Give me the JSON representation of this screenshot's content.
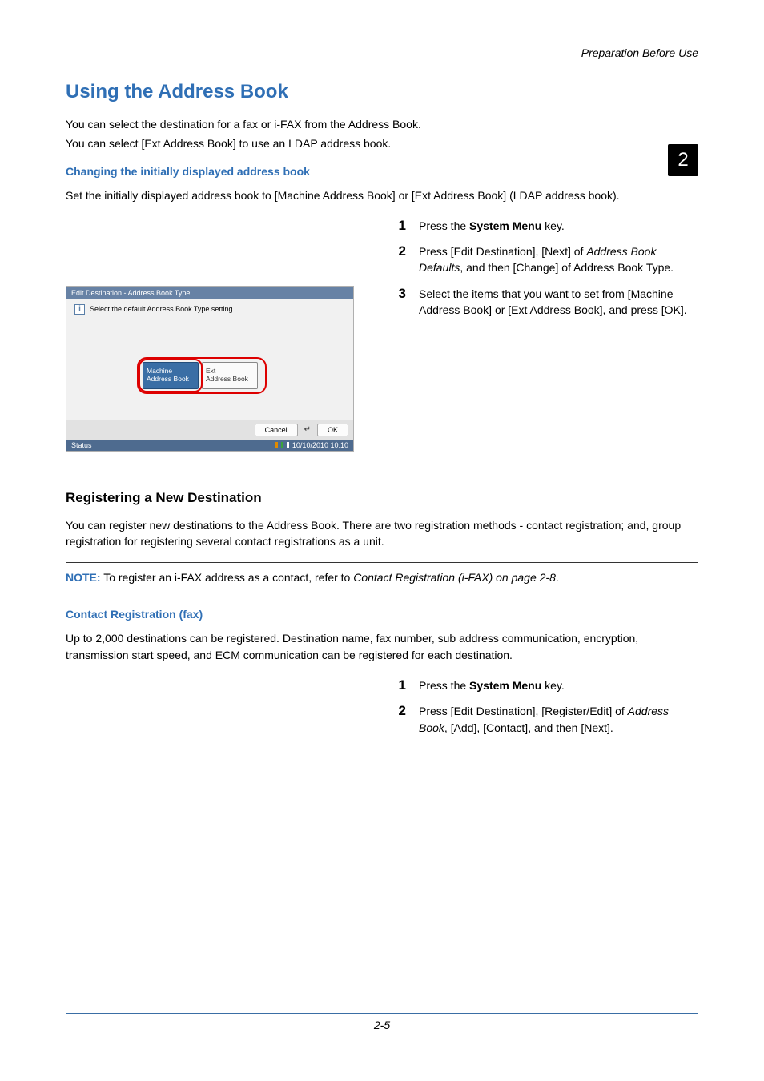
{
  "running_header": "Preparation Before Use",
  "chapter_number": "2",
  "section_title": "Using the Address Book",
  "intro": {
    "p1": "You can select the destination for a fax or i-FAX from the Address Book.",
    "p2": "You can select [Ext Address Book] to use an LDAP address book."
  },
  "sub_changing": {
    "heading": "Changing the initially displayed address book",
    "intro": "Set the initially displayed address book to [Machine Address Book] or [Ext Address Book] (LDAP address book).",
    "steps": {
      "s1_num": "1",
      "s1_text_a": "Press the ",
      "s1_text_b": "System Menu",
      "s1_text_c": " key.",
      "s2_num": "2",
      "s2_text_a": "Press [Edit Destination], [Next] of ",
      "s2_text_b": "Address Book Defaults",
      "s2_text_c": ", and then [Change] of Address Book Type.",
      "s3_num": "3",
      "s3_text": "Select the items that you want to set from [Machine Address Book] or [Ext Address Book], and press [OK]."
    }
  },
  "panel": {
    "title": "Edit Destination - Address Book Type",
    "info_text": "Select the default Address Book Type setting.",
    "btn_machine_l1": "Machine",
    "btn_machine_l2": "Address Book",
    "btn_ext_l1": "Ext",
    "btn_ext_l2": "Address Book",
    "cancel": "Cancel",
    "ok": "OK",
    "status_label": "Status",
    "timestamp": "10/10/2010  10:10"
  },
  "subsection_title": "Registering a New Destination",
  "register": {
    "intro": "You can register new destinations to the Address Book. There are two registration methods - contact registration; and, group registration for registering several contact registrations as a unit.",
    "note_label": "NOTE:",
    "note_text_a": " To register an i-FAX address as a contact, refer to ",
    "note_text_b": "Contact Registration (i-FAX) on page 2-8",
    "note_text_c": "."
  },
  "contact_fax": {
    "heading": "Contact Registration (fax)",
    "intro": "Up to 2,000 destinations can be registered. Destination name, fax number, sub address communication, encryption, transmission start speed, and ECM communication can be registered for each destination.",
    "steps": {
      "s1_num": "1",
      "s1_text_a": "Press the ",
      "s1_text_b": "System Menu",
      "s1_text_c": " key.",
      "s2_num": "2",
      "s2_text_a": "Press [Edit Destination], [Register/Edit] of ",
      "s2_text_b": "Address Book",
      "s2_text_c": ", [Add], [Contact], and then [Next]."
    }
  },
  "page_number": "2-5"
}
